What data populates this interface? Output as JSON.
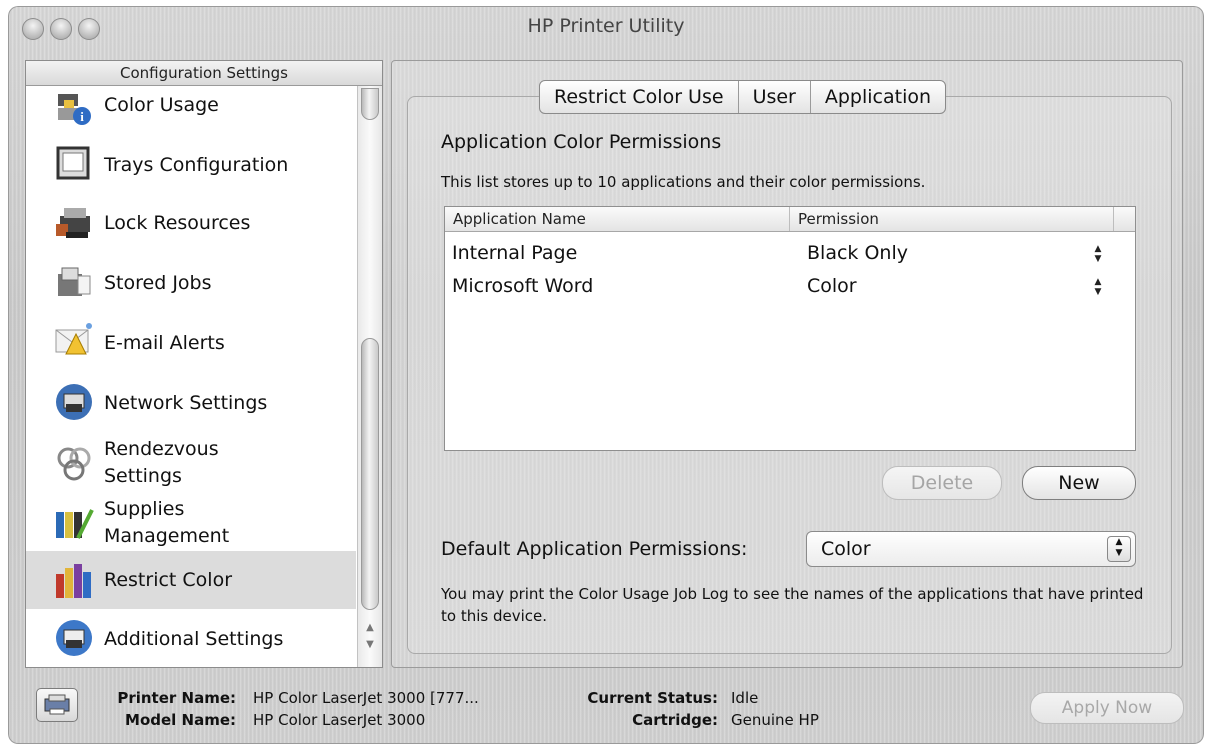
{
  "window": {
    "title": "HP Printer Utility"
  },
  "sidebar": {
    "header": "Configuration Settings",
    "items": [
      {
        "label": "Color Usage",
        "icon": "color-usage-icon"
      },
      {
        "label": "Trays Configuration",
        "icon": "tray-icon"
      },
      {
        "label": "Lock Resources",
        "icon": "lock-printer-icon"
      },
      {
        "label": "Stored Jobs",
        "icon": "stored-jobs-icon"
      },
      {
        "label": "E-mail Alerts",
        "icon": "email-alert-icon"
      },
      {
        "label": "Network Settings",
        "icon": "network-printer-icon"
      },
      {
        "label": "Rendezvous Settings",
        "line1": "Rendezvous",
        "line2": "Settings",
        "icon": "rendezvous-icon"
      },
      {
        "label": "Supplies Management",
        "line1": "Supplies",
        "line2": "Management",
        "icon": "supplies-icon"
      },
      {
        "label": "Restrict Color",
        "icon": "restrict-color-icon",
        "selected": true
      },
      {
        "label": "Additional Settings",
        "icon": "additional-settings-icon"
      }
    ]
  },
  "tabs": [
    "Restrict Color Use",
    "User",
    "Application"
  ],
  "main": {
    "section_title": "Application Color Permissions",
    "section_desc": "This list stores up to 10 applications and their color permissions.",
    "table": {
      "columns": [
        "Application Name",
        "Permission"
      ],
      "rows": [
        {
          "name": "Internal Page",
          "permission": "Black Only"
        },
        {
          "name": "Microsoft Word",
          "permission": "Color"
        }
      ]
    },
    "delete_label": "Delete",
    "new_label": "New",
    "default_label": "Default Application Permissions:",
    "default_value": "Color",
    "note": "You may print the Color Usage Job Log to see the names of the applications that have printed to this device."
  },
  "footer": {
    "printer_name_label": "Printer Name:",
    "printer_name": "HP Color LaserJet 3000 [777...",
    "model_name_label": "Model Name:",
    "model_name": "HP Color LaserJet 3000",
    "status_label": "Current Status:",
    "status": "Idle",
    "cartridge_label": "Cartridge:",
    "cartridge": "Genuine HP",
    "apply_label": "Apply Now"
  },
  "colors": {
    "window_bg": "#cfcfcf",
    "selected_row": "#dcdcdc",
    "disabled_text": "#a5a5a5"
  }
}
